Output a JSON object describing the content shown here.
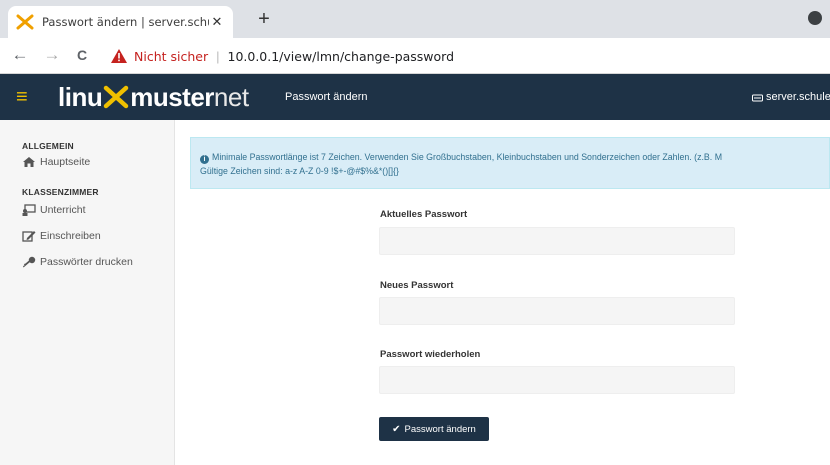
{
  "browser": {
    "tab_title": "Passwort ändern | server.schule.lo",
    "tab_close": "✕",
    "new_tab": "+",
    "not_secure": "Nicht sicher",
    "url": "10.0.0.1/view/lmn/change-password",
    "back_glyph": "←",
    "forward_glyph": "→",
    "reload_glyph": "C"
  },
  "header": {
    "logo_part1": "linu",
    "logo_part2": "muster",
    "logo_part3": "net",
    "page_title": "Passwort ändern",
    "server_label": "server.schule"
  },
  "sidebar": {
    "sections": [
      {
        "title": "ALLGEMEIN",
        "items": [
          {
            "label": "Hauptseite",
            "icon": "home-icon"
          }
        ]
      },
      {
        "title": "KLASSENZIMMER",
        "items": [
          {
            "label": "Unterricht",
            "icon": "classroom-icon"
          },
          {
            "label": "Einschreiben",
            "icon": "edit-icon"
          },
          {
            "label": "Passwörter drucken",
            "icon": "key-icon"
          }
        ]
      }
    ]
  },
  "info": {
    "line1": "Minimale Passwortlänge ist 7 Zeichen. Verwenden Sie Großbuchstaben, Kleinbuchstaben und Sonderzeichen oder Zahlen. (z.B. M",
    "line2": "Gültige Zeichen sind: a-z A-Z 0-9 !$+-@#$%&*()[]{}"
  },
  "form": {
    "current_label": "Aktuelles Passwort",
    "current_value": "",
    "new_label": "Neues Passwort",
    "new_value": "",
    "repeat_label": "Passwort wiederholen",
    "repeat_value": "",
    "submit_label": "Passwort ändern"
  },
  "colors": {
    "header_bg": "#1e3246",
    "accent": "#f0c000",
    "info_bg": "#d9edf7",
    "info_text": "#31708f"
  }
}
